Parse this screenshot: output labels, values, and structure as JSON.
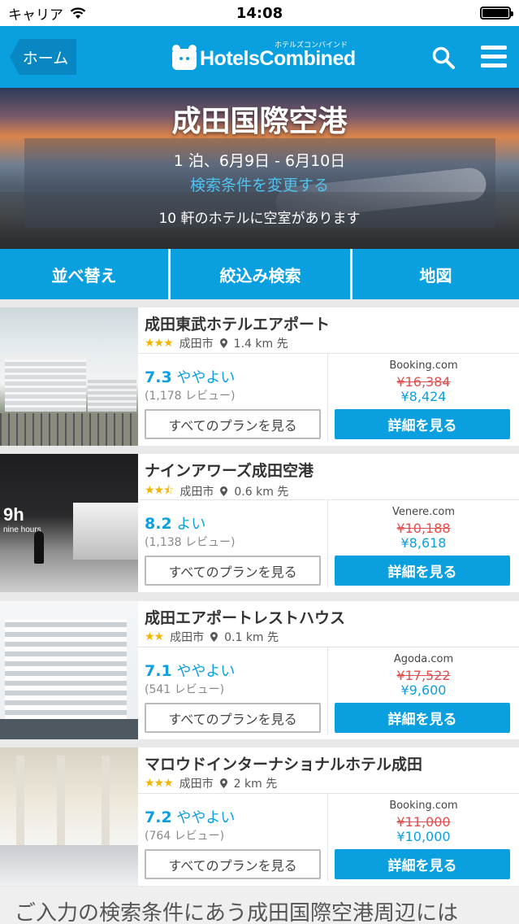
{
  "status_bar": {
    "carrier": "キャリア",
    "time": "14:08"
  },
  "nav": {
    "home_label": "ホーム",
    "logo_kana": "ホテルズコンバインド",
    "logo_text": "HotelsCombined",
    "accent_color": "#0aa0e0"
  },
  "hero": {
    "title": "成田国際空港",
    "dates": "1 泊、6月9日 - 6月10日",
    "change_link": "検索条件を変更する",
    "availability": "10 軒のホテルに空室があります"
  },
  "toolbar": {
    "sort_label": "並べ替え",
    "filter_label": "絞込み検索",
    "map_label": "地図"
  },
  "hotels": [
    {
      "name": "成田東武ホテルエアポート",
      "stars": "★★★",
      "city": "成田市",
      "distance": "1.4 km 先",
      "score": "7.3",
      "rating_text": "ややよい",
      "reviews": "(1,178 レビュー)",
      "plans_label": "すべてのプランを見る",
      "provider": "Booking.com",
      "old_price": "¥16,384",
      "new_price": "¥8,424",
      "details_label": "詳細を見る"
    },
    {
      "name": "ナインアワーズ成田空港",
      "stars": "★★⯪",
      "city": "成田市",
      "distance": "0.6 km 先",
      "score": "8.2",
      "rating_text": "よい",
      "reviews": "(1,138 レビュー)",
      "plans_label": "すべてのプランを見る",
      "provider": "Venere.com",
      "old_price": "¥10,188",
      "new_price": "¥8,618",
      "details_label": "詳細を見る",
      "photo_sign": "9h",
      "photo_sign_sub": "nine hours"
    },
    {
      "name": "成田エアポートレストハウス",
      "stars": "★★",
      "city": "成田市",
      "distance": "0.1 km 先",
      "score": "7.1",
      "rating_text": "ややよい",
      "reviews": "(541 レビュー)",
      "plans_label": "すべてのプランを見る",
      "provider": "Agoda.com",
      "old_price": "¥17,522",
      "new_price": "¥9,600",
      "details_label": "詳細を見る"
    },
    {
      "name": "マロウドインターナショナルホテル成田",
      "stars": "★★★",
      "city": "成田市",
      "distance": "2 km 先",
      "score": "7.2",
      "rating_text": "ややよい",
      "reviews": "(764 レビュー)",
      "plans_label": "すべてのプランを見る",
      "provider": "Booking.com",
      "old_price": "¥11,000",
      "new_price": "¥10,000",
      "details_label": "詳細を見る"
    }
  ],
  "footer": {
    "text": "ご入力の検索条件にあう成田国際空港周辺には"
  }
}
